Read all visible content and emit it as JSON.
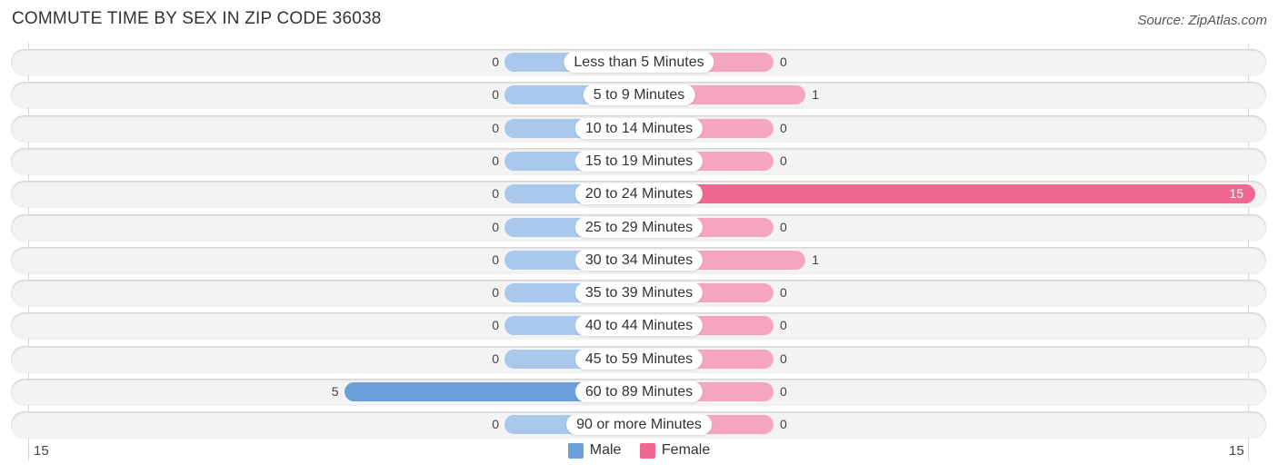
{
  "title": "COMMUTE TIME BY SEX IN ZIP CODE 36038",
  "source": "Source: ZipAtlas.com",
  "colors": {
    "male": "#a9c8ec",
    "male_strong": "#6a9fdb",
    "female": "#f6a5bf",
    "female_strong": "#f06792",
    "legend_male": "#6a9fdb",
    "legend_female": "#f06792"
  },
  "chart_data": {
    "type": "bar",
    "orientation": "diverging-horizontal",
    "title": "COMMUTE TIME BY SEX IN ZIP CODE 36038",
    "categories": [
      "Less than 5 Minutes",
      "5 to 9 Minutes",
      "10 to 14 Minutes",
      "15 to 19 Minutes",
      "20 to 24 Minutes",
      "25 to 29 Minutes",
      "30 to 34 Minutes",
      "35 to 39 Minutes",
      "40 to 44 Minutes",
      "45 to 59 Minutes",
      "60 to 89 Minutes",
      "90 or more Minutes"
    ],
    "series": [
      {
        "name": "Male",
        "values": [
          0,
          0,
          0,
          0,
          0,
          0,
          0,
          0,
          0,
          0,
          5,
          0
        ]
      },
      {
        "name": "Female",
        "values": [
          0,
          1,
          0,
          0,
          15,
          0,
          1,
          0,
          0,
          0,
          0,
          0
        ]
      }
    ],
    "axis": {
      "left_tick": "15",
      "right_tick": "15",
      "range": [
        15,
        15
      ]
    },
    "legend": {
      "position": "bottom-center",
      "entries": [
        "Male",
        "Female"
      ]
    },
    "grid": false
  }
}
